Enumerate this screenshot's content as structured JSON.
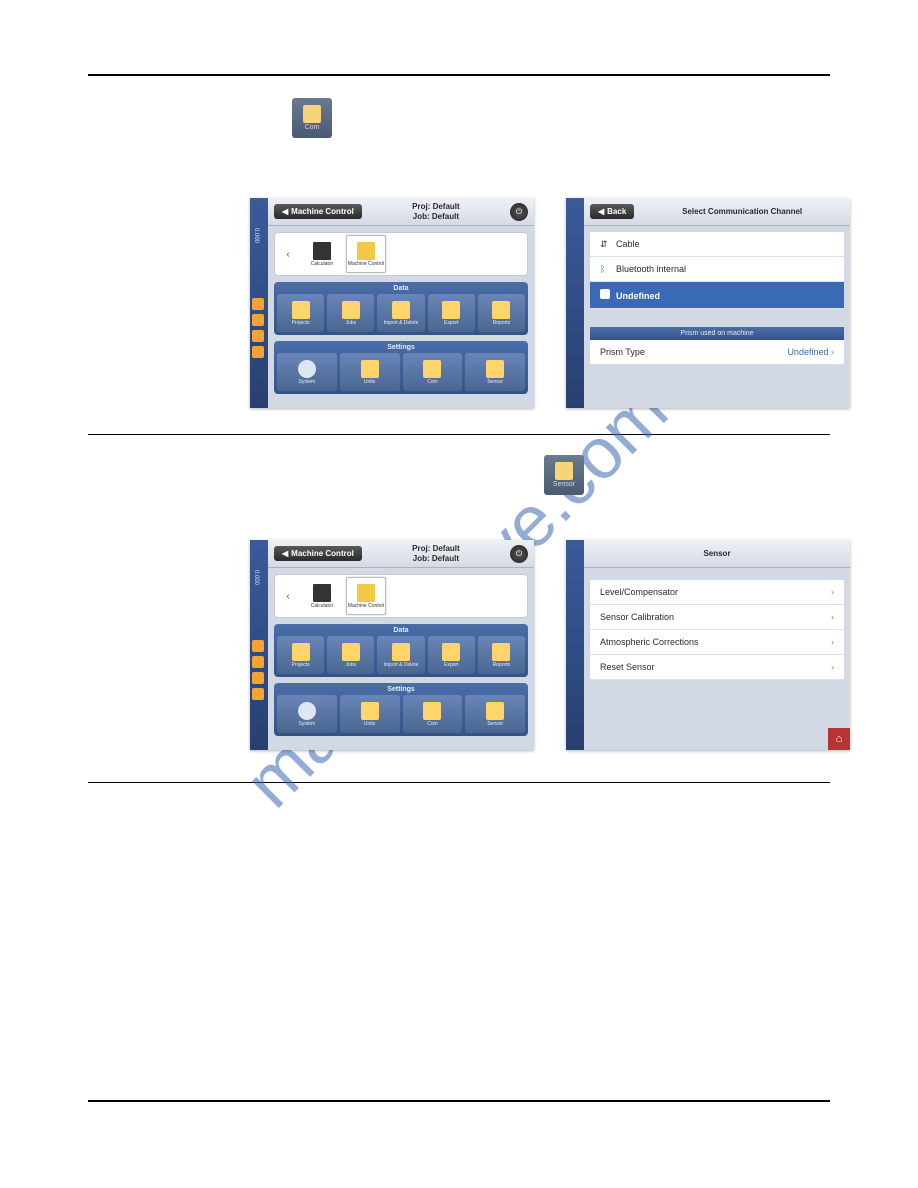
{
  "watermark_text": "manualshive.com",
  "tiles": {
    "com_label": "Com",
    "sensor_label": "Sensor"
  },
  "main_panel": {
    "back_label": "Machine Control",
    "proj_line": "Proj: Default",
    "job_line": "Job: Default",
    "sidebar_value": "0.000",
    "apps": {
      "calculator": "Calculator",
      "machine_control": "Machine Control"
    },
    "data_section": {
      "title": "Data",
      "items": [
        "Projects",
        "Jobs",
        "Import & Delete",
        "Export",
        "Reports"
      ]
    },
    "settings_section": {
      "title": "Settings",
      "items": [
        "System",
        "Units",
        "Com",
        "Sensor"
      ]
    }
  },
  "comm_panel": {
    "back_label": "Back",
    "title": "Select Communication Channel",
    "rows": {
      "cable": "Cable",
      "bluetooth": "Bluetooth internal",
      "undefined": "Undefined"
    },
    "prism_header": "Prism used on machine",
    "prism_type_label": "Prism Type",
    "prism_type_value": "Undefined"
  },
  "sensor_panel": {
    "title": "Sensor",
    "rows": [
      "Level/Compensator",
      "Sensor Calibration",
      "Atmospheric Corrections",
      "Reset Sensor"
    ]
  }
}
